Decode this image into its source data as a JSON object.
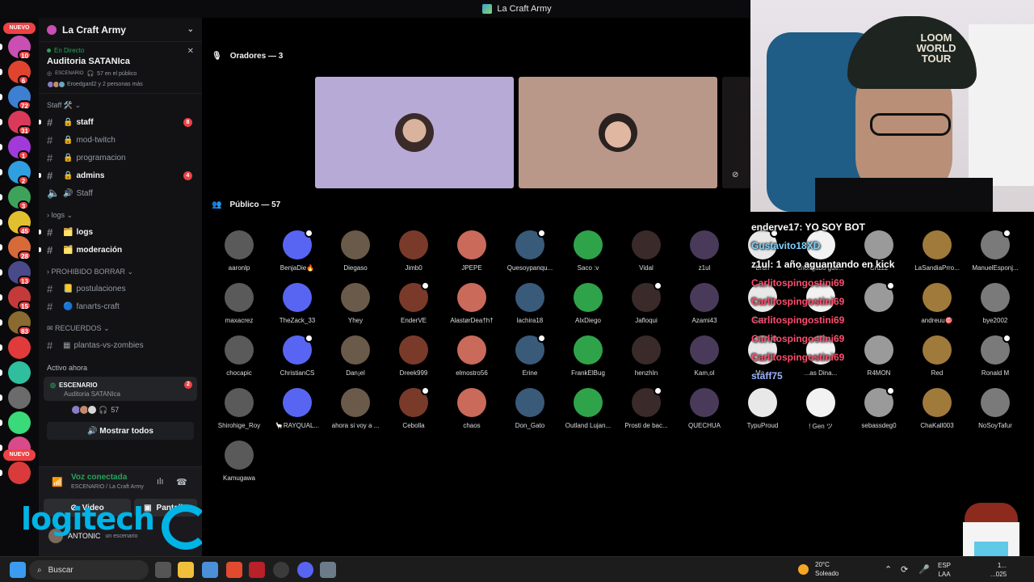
{
  "window": {
    "title": "La Craft Army"
  },
  "server_rail": {
    "badges": [
      "10",
      "6",
      "72",
      "31",
      "1",
      "2",
      "3",
      "45",
      "28",
      "13",
      "15",
      "83"
    ],
    "nuevo": "NUEVO"
  },
  "sidebar": {
    "server_name": "La Craft Army",
    "live": {
      "tag": "En Directo",
      "name": "Auditoria SATANIca",
      "stage_label": "ESCENARIO",
      "public_count": "57 en el público",
      "participants": "Eroedgard2 y 2 personas más"
    },
    "categories": {
      "staff": "Staff 🛠️",
      "logs": "logs",
      "prohibido": "PROHIBIDO BORRAR",
      "recuerdos": "RECUERDOS"
    },
    "channels": [
      {
        "name": "staff",
        "badge": "8"
      },
      {
        "name": "mod-twitch"
      },
      {
        "name": "programacion"
      },
      {
        "name": "admins",
        "badge": "4"
      },
      {
        "name": "Staff"
      },
      {
        "name": "logs"
      },
      {
        "name": "moderación"
      },
      {
        "name": "postulaciones"
      },
      {
        "name": "fanarts-craft"
      },
      {
        "name": "plantas-vs-zombies"
      }
    ],
    "active_now": "Activo ahora",
    "active_card": {
      "title": "ESCENARIO",
      "subtitle": "Auditoria SATANIca",
      "badge": "2",
      "count": "57"
    },
    "show_all": "Mostrar todos"
  },
  "voice": {
    "status": "Voz conectada",
    "location": "ESCENARIO / La Craft Army",
    "video": "Video",
    "screen": "Pantalla",
    "user": "ANTONIC",
    "user_sub": "un escenario"
  },
  "overlay": {
    "logi_text": "logitech",
    "tm": "TM"
  },
  "stage": {
    "speakers_header": "Oradores — 3",
    "public_header": "Público — 57",
    "speaker_tiles": [
      {
        "color": "#b8aad6"
      },
      {
        "color": "#b9988a"
      }
    ],
    "audience": [
      "aaronlp",
      "BenjaDie🔥",
      "Diegaso",
      "Jimb0",
      "JPEPE",
      "Quesoypanqu...",
      "Saco :v",
      "Vidal",
      "z1ul",
      "Brun",
      "chongabo gue...",
      "Crizzz",
      "LaSandiaPrro...",
      "ManuelEsponj...",
      "maxacrez",
      "TheZack_33",
      "Yhey",
      "EnderVE",
      "AlastørDea†h†",
      "lachira18",
      "AlxDiego",
      "Jafloqui",
      "Azami43",
      "FAR...",
      "",
      "",
      "andreuu🎯",
      "bye2002",
      "chocapic",
      "ChristianCS",
      "Dan¡el",
      "Dreek999",
      "elmostro56",
      "Erine",
      "FrankElBug",
      "henzhIn",
      "Kam,ol",
      "Ma...",
      "...as Dina...",
      "R4MON",
      "Red",
      "Ronald M",
      "Shirohige_Roy",
      "🦙RAYQUAL...",
      "ahora si voy a ...",
      "Cebolla",
      "chaos",
      "Don_Gato",
      "Outland Lujan...",
      "Prosti de bac...",
      "QUECHUA",
      "TypuProud",
      "! Gen ツ",
      "sebassdeg0",
      "ChaKall003",
      "NoSoyTafur",
      "Kamugawa"
    ]
  },
  "chat": [
    {
      "user": "enderve17",
      "text": "YO SOY BOT",
      "color": "#ffffff"
    },
    {
      "user": "Gustavito18XD",
      "text": "",
      "color": "#7fd3ff"
    },
    {
      "user": "z1ul",
      "text": "1 año aguantando en kick",
      "color": "#ffffff"
    },
    {
      "user": "Carlitospingostini69",
      "text": "",
      "color": "#ff4d6d"
    },
    {
      "user": "Carlitospingostini69",
      "text": "",
      "color": "#ff4d6d"
    },
    {
      "user": "Carlitospingostini69",
      "text": "",
      "color": "#ff4d6d"
    },
    {
      "user": "Carlitospingostini69",
      "text": "",
      "color": "#ff4d6d"
    },
    {
      "user": "Carlitospingostini69",
      "text": "",
      "color": "#ff4d6d"
    },
    {
      "user": "staff75",
      "text": "",
      "color": "#9ab6ff"
    }
  ],
  "webcam": {
    "hat_text": "LOOM WORLD TOUR"
  },
  "taskbar": {
    "search": "Buscar",
    "weather_temp": "20°C",
    "weather_desc": "Soleado",
    "lang1": "ESP",
    "lang2": "LAA",
    "clock1": "1...",
    "clock2": "...025"
  }
}
